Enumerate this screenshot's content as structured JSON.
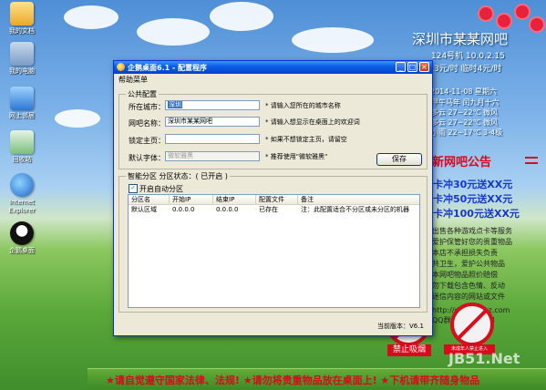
{
  "desktop": {
    "icons": [
      {
        "label": "我的文档"
      },
      {
        "label": "我的电脑"
      },
      {
        "label": "网上邻居"
      },
      {
        "label": "回收站"
      },
      {
        "label": "Internet Explorer"
      },
      {
        "label": "企鹅桌面"
      }
    ],
    "cafe_name": "深圳市某某网吧",
    "machine_info": "124号机 10.0.2.15",
    "price_info": "3元/时 临时4元/时",
    "date_line": "2014-11-08 星期六",
    "lunar_line": "甲午马年 闰九月十六",
    "weather": [
      "多云 27~22℃ 微风",
      "多云 27~22℃ 微风",
      "小雨 22~17℃ 3-4级"
    ],
    "notice_title": "新网吧公告",
    "promos": [
      "卡冲30元送XX元",
      "卡冲50元送XX元",
      "卡冲100元送XX元"
    ],
    "rules": [
      "出售各种游戏点卡等服务",
      "爱护保管好您的贵重物品",
      "本店不承担损失负责",
      "共卫生，爱护公共物品",
      "本网吧物品照价赔偿",
      "勿下载包含色情、反动",
      "迷信内容的网站或文件"
    ],
    "site_url": "http://desk.wpsz.com",
    "qq": "QQ群:340461194",
    "no_smoking": "禁止吸烟",
    "no_minors": "未成年人禁止进入",
    "footer": "★请自觉遵守国家法律、法规! ★请勿将贵重物品放在桌面上! ★下机请带齐随身物品",
    "watermark": "JB51.Net"
  },
  "window": {
    "title": "企鹅桌面6.1 - 配置程序",
    "min_glyph": "_",
    "max_glyph": "□",
    "close_glyph": "×",
    "menu": "帮助菜单",
    "public_legend": "公共配置",
    "fields": {
      "city_label": "所在城市：",
      "city_value": "深圳",
      "city_hint": "* 请输入您所在的城市名称",
      "name_label": "网吧名称：",
      "name_value": "深圳市某某网吧",
      "name_hint": "* 请输入想显示在桌面上的欢迎词",
      "home_label": "锁定主页：",
      "home_value": "",
      "home_hint": "* 如果不想锁定主页，请留空",
      "font_label": "默认字体：",
      "font_value": "微软雅黑",
      "font_hint": "* 推荐使用\"微软雅黑\""
    },
    "save_label": "保存",
    "zone_legend": "智能分区 分区状态：( 已开启 )",
    "checkbox_label": "开启自动分区",
    "checkbox_mark": "✓",
    "table": {
      "headers": [
        "分区名",
        "开始IP",
        "结束IP",
        "配置文件",
        "备注"
      ],
      "rows": [
        [
          "默认区域",
          "0.0.0.0",
          "0.0.0.0",
          "已存在",
          "注：此配置适合不分区或未分区的机器"
        ]
      ]
    },
    "version": "当前版本：V6.1"
  }
}
